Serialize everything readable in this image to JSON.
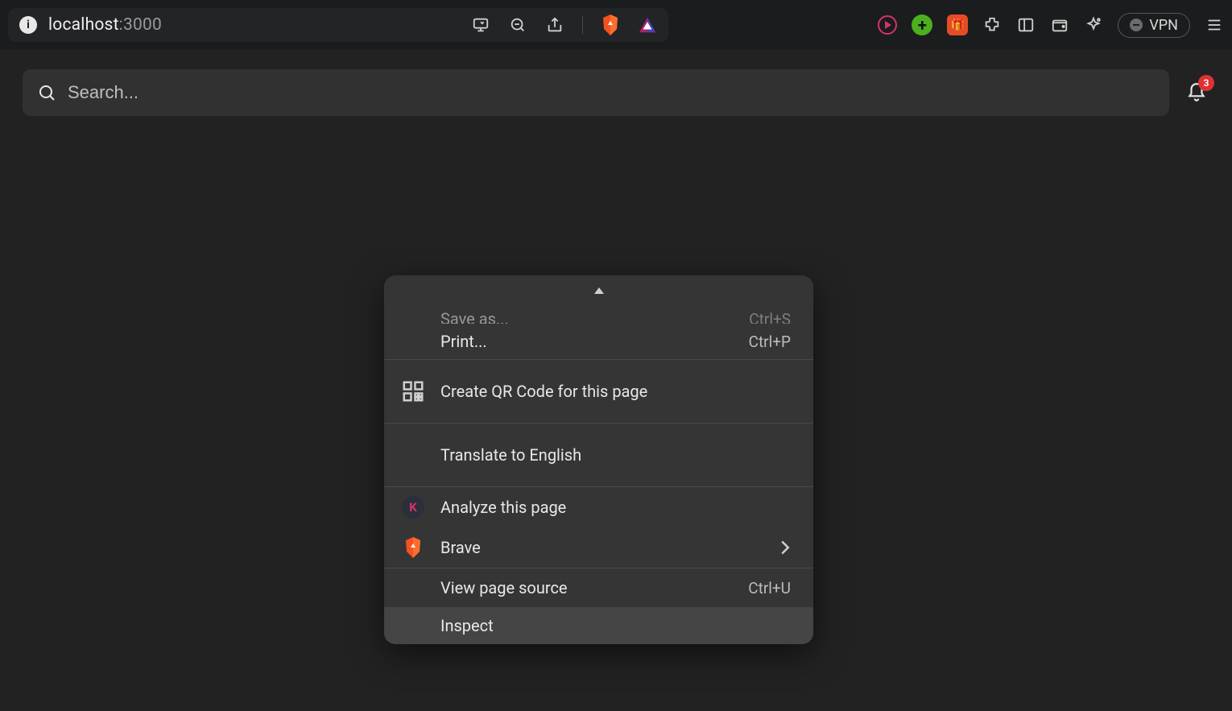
{
  "browser": {
    "url_host": "localhost",
    "url_port": ":3000",
    "vpn_label": "VPN",
    "ext_plus_label": "+",
    "ext_gift_label": "🎁"
  },
  "page": {
    "search_placeholder": "Search...",
    "notification_count": "3"
  },
  "context_menu": {
    "save_as": {
      "label": "Save as...",
      "shortcut": "Ctrl+S"
    },
    "print": {
      "label": "Print...",
      "shortcut": "Ctrl+P"
    },
    "qr": {
      "label": "Create QR Code for this page"
    },
    "translate": {
      "label": "Translate to English"
    },
    "analyze": {
      "label": "Analyze this page",
      "badge": "K"
    },
    "brave": {
      "label": "Brave"
    },
    "view_source": {
      "label": "View page source",
      "shortcut": "Ctrl+U"
    },
    "inspect": {
      "label": "Inspect"
    }
  }
}
